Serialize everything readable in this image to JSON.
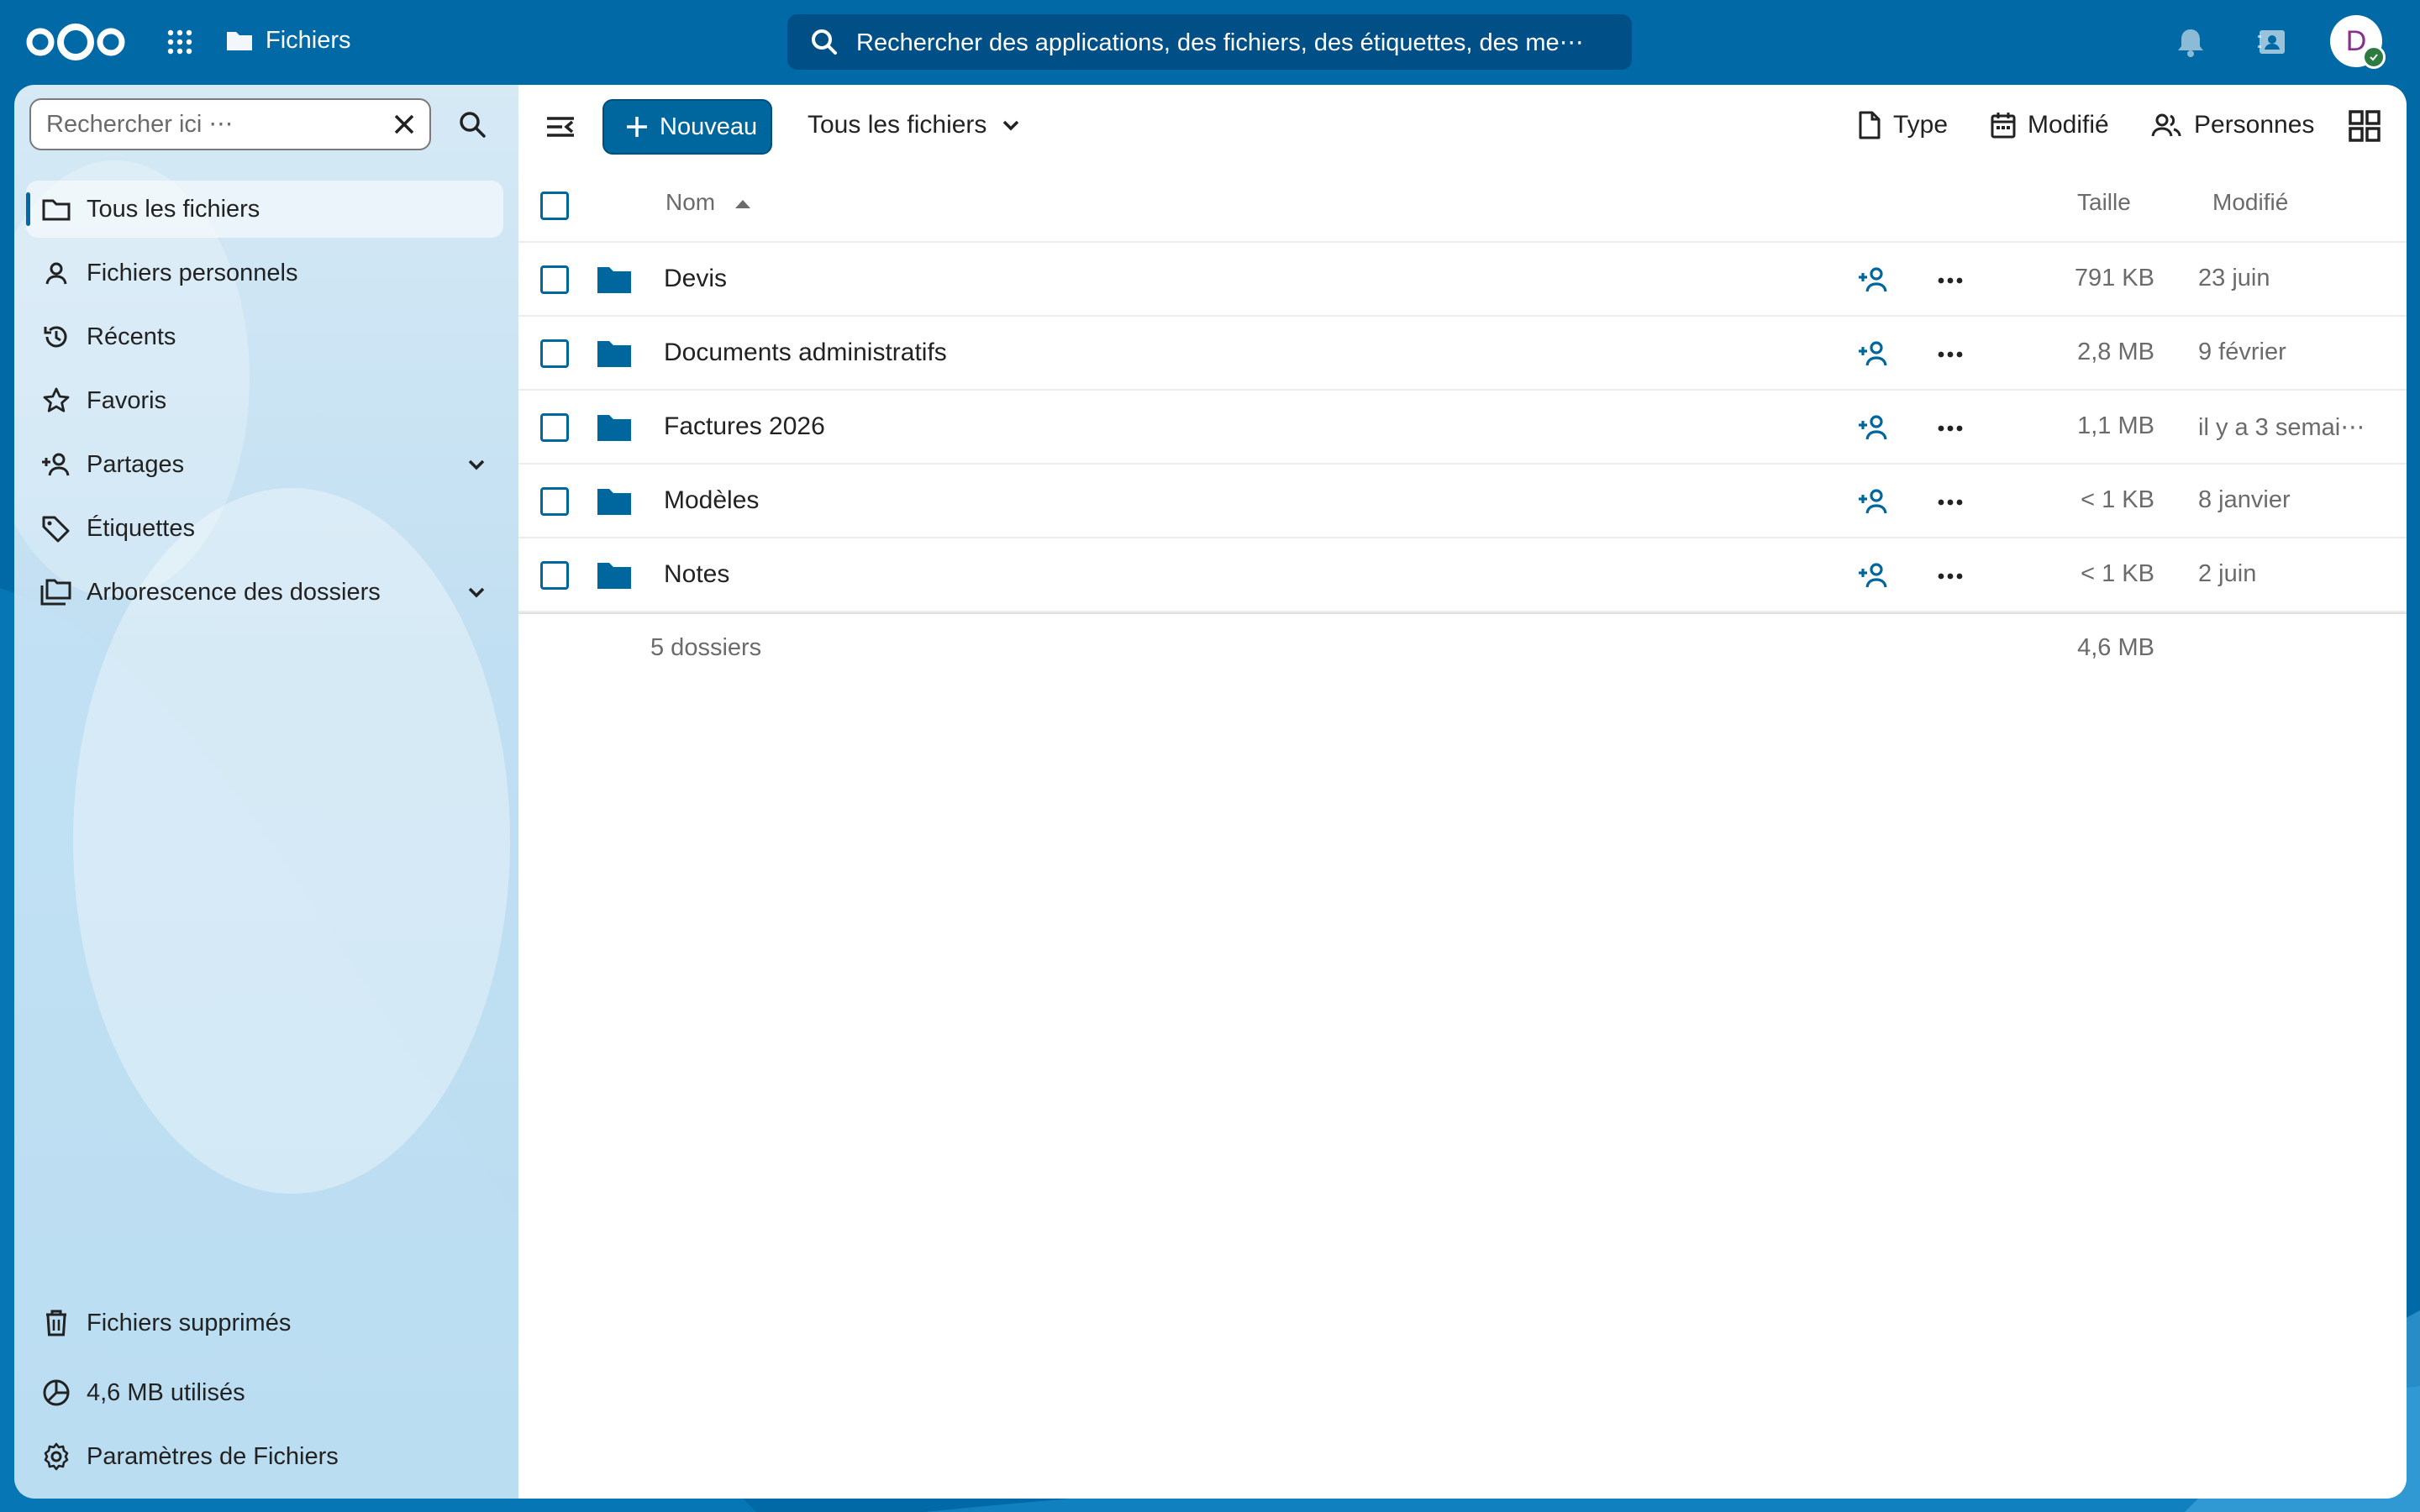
{
  "header": {
    "app_name": "Fichiers",
    "search_placeholder": "Rechercher des applications, des fichiers, des étiquettes, des me⋯",
    "avatar_initial": "D"
  },
  "sidebar": {
    "search_placeholder": "Rechercher ici ⋯",
    "items": [
      {
        "label": "Tous les fichiers",
        "icon": "folder-icon",
        "active": true
      },
      {
        "label": "Fichiers personnels",
        "icon": "user-icon"
      },
      {
        "label": "Récents",
        "icon": "history-icon"
      },
      {
        "label": "Favoris",
        "icon": "star-icon"
      },
      {
        "label": "Partages",
        "icon": "share-icon",
        "expandable": true
      },
      {
        "label": "Étiquettes",
        "icon": "tag-icon"
      },
      {
        "label": "Arborescence des dossiers",
        "icon": "folder-tree-icon",
        "expandable": true
      }
    ],
    "bottom": {
      "trash": "Fichiers supprimés",
      "quota": "4,6 MB utilisés",
      "settings": "Paramètres de Fichiers"
    }
  },
  "toolbar": {
    "new_label": "Nouveau",
    "breadcrumb": "Tous les fichiers",
    "filters": {
      "type": "Type",
      "modified": "Modifié",
      "people": "Personnes"
    }
  },
  "table": {
    "columns": {
      "name": "Nom",
      "size": "Taille",
      "modified": "Modifié"
    },
    "rows": [
      {
        "name": "Devis",
        "size": "791 KB",
        "modified": "23 juin"
      },
      {
        "name": "Documents administratifs",
        "size": "2,8 MB",
        "modified": "9 février"
      },
      {
        "name": "Factures 2026",
        "size": "1,1 MB",
        "modified": "il y a 3 semai⋯"
      },
      {
        "name": "Modèles",
        "size": "< 1 KB",
        "modified": "8 janvier"
      },
      {
        "name": "Notes",
        "size": "< 1 KB",
        "modified": "2 juin"
      }
    ],
    "summary": {
      "count": "5 dossiers",
      "total": "4,6 MB"
    }
  },
  "colors": {
    "primary": "#00679e",
    "header_bg": "#0069a6",
    "status_online": "#2d7b41"
  }
}
